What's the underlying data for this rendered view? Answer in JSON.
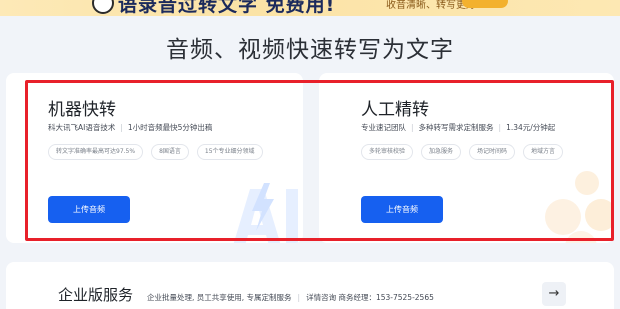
{
  "banner": {
    "title": "语录音过转文字 免费用!",
    "subtitle": "收音清晰、转写更好"
  },
  "heading": "音频、视频快速转写为文字",
  "cards": [
    {
      "title": "机器快转",
      "desc_parts": [
        "科大讯飞AI语音技术",
        "1小时音频最快5分钟出稿"
      ],
      "tags": [
        "转文字准确率最高可达97.5%",
        "8国语言",
        "15个专业细分领域"
      ],
      "button": "上传音频"
    },
    {
      "title": "人工精转",
      "desc_parts": [
        "专业速记团队",
        "多种转写需求定制服务",
        "1.34元/分钟起"
      ],
      "tags": [
        "多轮审核校验",
        "加急服务",
        "场记时间码",
        "地域方言"
      ],
      "button": "上传音频"
    }
  ],
  "enterprise": {
    "title": "企业版服务",
    "desc_parts": [
      "企业批量处理, 员工共享使用, 专属定制服务",
      "详情咨询 商务经理：153-7525-2565"
    ],
    "arrow": "→"
  },
  "colors": {
    "primary": "#1660f0",
    "highlight": "#e8202a",
    "background": "#f1f4f9"
  }
}
